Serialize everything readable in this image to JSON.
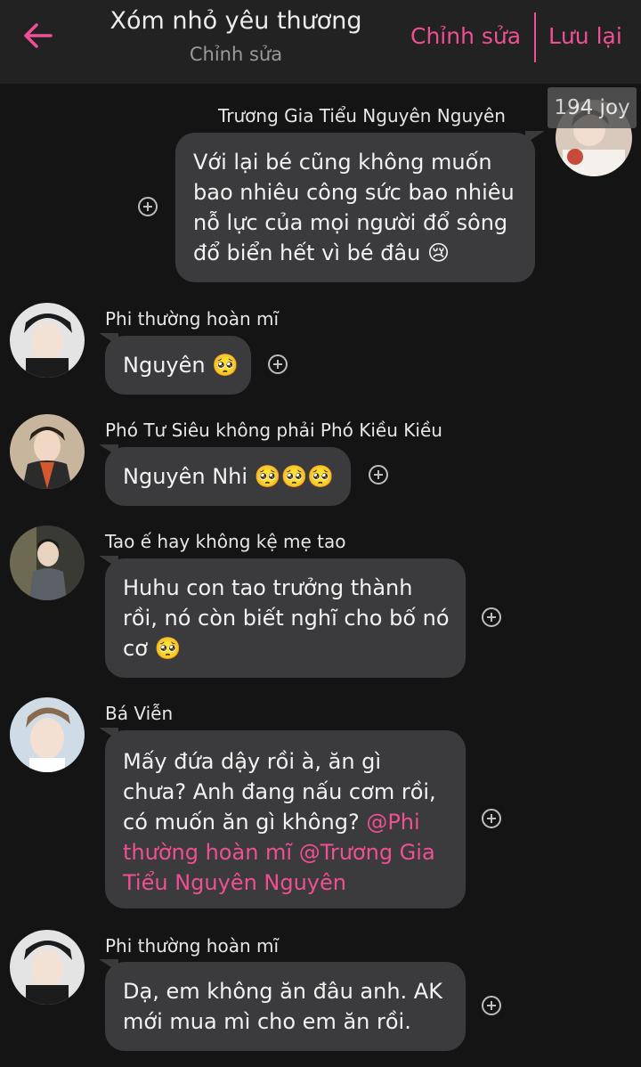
{
  "header": {
    "title": "Xóm nhỏ yêu thương",
    "subtitle": "Chỉnh sửa",
    "edit_label": "Chỉnh sửa",
    "save_label": "Lưu lại",
    "accent_color": "#ef4f93"
  },
  "watermark": "194 joy",
  "messages": [
    {
      "sender": "Trương Gia Tiểu Nguyên Nguyên",
      "side": "right",
      "lines": [
        "Với lại bé cũng không muốn",
        "bao nhiêu công sức bao nhiêu",
        "nỗ lực của mọi người đổ sông",
        "đổ biển hết vì bé đâu 😢"
      ]
    },
    {
      "sender": "Phi thường hoàn mĩ",
      "side": "left",
      "lines": [
        "Nguyên 🥺"
      ]
    },
    {
      "sender": "Phó Tư Siêu không phải Phó Kiều Kiều",
      "side": "left",
      "lines": [
        "Nguyên Nhi 🥺🥺🥺"
      ]
    },
    {
      "sender": "Tao ế hay không kệ mẹ tao",
      "side": "left",
      "lines": [
        "Huhu con tao trưởng thành",
        "rồi, nó còn biết nghĩ cho bố nó",
        "cơ 🥺"
      ]
    },
    {
      "sender": "Bá Viễn",
      "side": "left",
      "lines": [
        "Mấy đứa dậy rồi à, ăn gì",
        "chưa? Anh đang nấu cơm rồi,",
        "có muốn ăn gì không? "
      ],
      "mention_lines": [
        "@Phi",
        "thường hoàn mĩ @Trương Gia",
        "Tiểu Nguyên Nguyên"
      ]
    },
    {
      "sender": "Phi thường hoàn mĩ",
      "side": "left",
      "lines": [
        "Dạ, em không ăn đâu anh. AK",
        "mới mua mì cho em ăn rồi."
      ]
    }
  ]
}
